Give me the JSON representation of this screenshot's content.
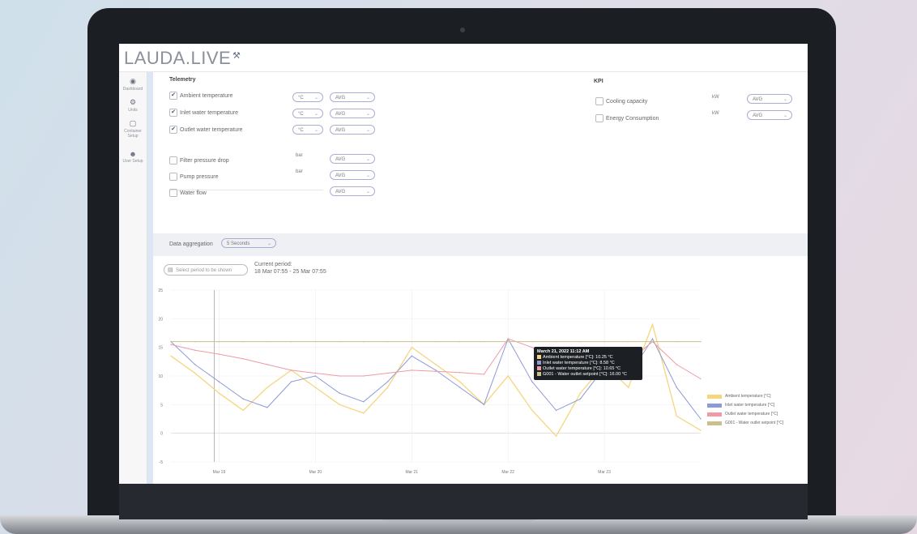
{
  "app": {
    "logo": "LAUDA.LIVE"
  },
  "sidebar": {
    "items": [
      {
        "label": "Dashboard",
        "icon": "dashboard-icon"
      },
      {
        "label": "Units",
        "icon": "gears-icon"
      },
      {
        "label": "Container Setup",
        "icon": "container-icon"
      },
      {
        "label": "User Setup",
        "icon": "user-icon"
      }
    ]
  },
  "telemetry": {
    "title": "Telemetry",
    "rows": [
      {
        "label": "Ambient temperature",
        "checked": true,
        "unit": "°C",
        "agg": "AVG"
      },
      {
        "label": "Inlet water temperature",
        "checked": true,
        "unit": "°C",
        "agg": "AVG"
      },
      {
        "label": "Outlet water temperature",
        "checked": true,
        "unit": "°C",
        "agg": "AVG"
      },
      {
        "label": "Filter pressure drop",
        "checked": false,
        "unit": "bar",
        "agg": "AVG"
      },
      {
        "label": "Pump pressure",
        "checked": false,
        "unit": "bar",
        "agg": "AVG"
      },
      {
        "label": "Water flow",
        "checked": false,
        "unit": "",
        "agg": "AVG"
      }
    ]
  },
  "kpi": {
    "title": "KPI",
    "rows": [
      {
        "label": "Cooling capacity",
        "checked": false,
        "unit": "kW",
        "agg": "AVG"
      },
      {
        "label": "Energy Consumption",
        "checked": false,
        "unit": "kW",
        "agg": "AVG"
      }
    ]
  },
  "aggregation": {
    "label": "Data aggregation",
    "value": "5 Seconds"
  },
  "period": {
    "button": "Select period to be shown",
    "current_label": "Current period:",
    "current_value": "18 Mar 07:55 - 25 Mar 07:55"
  },
  "tooltip": {
    "title": "March 21, 2022 11:12 AM",
    "lines": [
      "Ambient temperature [°C]: 10.25 °C",
      "Inlet water temperature [°C]: 8.58 °C",
      "Outlet water temperature [°C]: 10.65 °C",
      "G001 - Water outlet setpoint [°C]: 16.00 °C"
    ]
  },
  "colors": {
    "ambient": "#f6d57e",
    "inlet": "#8e9ad6",
    "outlet": "#ef9aa6",
    "setpoint": "#c9c08a"
  },
  "chart_data": {
    "type": "line",
    "title": "",
    "xlabel": "",
    "ylabel": "",
    "x_ticks": [
      "Mar 19",
      "Mar 20",
      "Mar 21",
      "Mar 22",
      "Mar 23"
    ],
    "y_ticks": [
      25,
      20,
      15,
      10,
      5,
      0,
      -5
    ],
    "ylim": [
      -5,
      25
    ],
    "x": [
      0.0,
      0.25,
      0.5,
      0.75,
      1.0,
      1.25,
      1.5,
      1.75,
      2.0,
      2.25,
      2.5,
      2.75,
      3.0,
      3.25,
      3.5,
      3.75,
      4.0,
      4.25,
      4.5,
      4.75,
      5.0,
      5.25,
      5.5
    ],
    "series": [
      {
        "name": "Ambient temperature [°C]",
        "values": [
          13.5,
          10.5,
          7,
          4,
          8,
          11,
          8,
          5,
          3.5,
          8,
          15,
          12,
          9,
          5,
          10,
          4,
          -0.5,
          7,
          12,
          8,
          19,
          3,
          0.5
        ]
      },
      {
        "name": "Inlet water temperature [°C]",
        "values": [
          16,
          12,
          9,
          6,
          4.5,
          9,
          10,
          7,
          5.5,
          9,
          13.5,
          11,
          8,
          5,
          16.5,
          9,
          4,
          6,
          11.5,
          10,
          16.5,
          8,
          2.5
        ]
      },
      {
        "name": "Outlet water temperature [°C]",
        "values": [
          15.5,
          14.5,
          13.8,
          13,
          12,
          11,
          10.5,
          10,
          10,
          10.5,
          11,
          10.8,
          10.6,
          10.3,
          16.5,
          15,
          12.5,
          11.5,
          12.5,
          12.5,
          16,
          12,
          9.5
        ]
      },
      {
        "name": "G001 - Water outlet setpoint [°C]",
        "values": [
          16,
          16,
          16,
          16,
          16,
          16,
          16,
          16,
          16,
          16,
          16,
          16,
          16,
          16,
          16,
          16,
          16,
          16,
          16,
          16,
          16,
          16,
          16
        ]
      }
    ],
    "legend": "right",
    "grid": true
  }
}
